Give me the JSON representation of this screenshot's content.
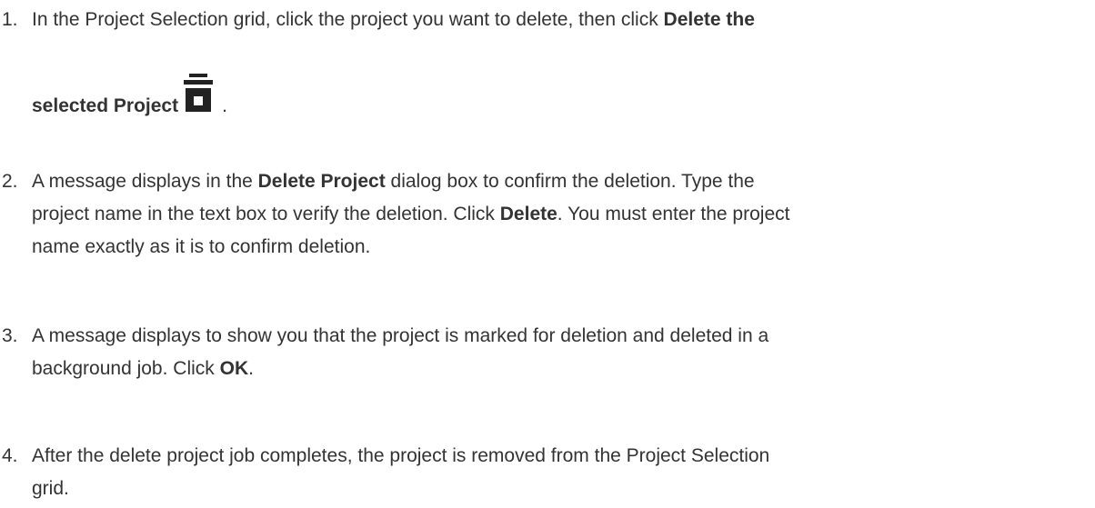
{
  "steps": [
    {
      "number": "1.",
      "line1_prefix": "In the Project Selection grid, click the project you want to delete, then click ",
      "line1_bold": "Delete the",
      "line2_bold": "selected Project",
      "line2_suffix": ".",
      "icon": "trash-can-icon"
    },
    {
      "number": "2.",
      "line1_prefix": "A message displays in the ",
      "line1_bold": "Delete Project",
      "line1_suffix": " dialog box to confirm the deletion. Type the",
      "line2_prefix": "project name in the text box to verify the deletion. Click ",
      "line2_bold": "Delete",
      "line2_suffix": ". You must enter the project",
      "line3": "name exactly as it is to confirm deletion."
    },
    {
      "number": "3.",
      "line1": "A message displays to show you that the project is marked for deletion and deleted in a",
      "line2_prefix": "background job. Click ",
      "line2_bold": "OK",
      "line2_suffix": "."
    },
    {
      "number": "4.",
      "line1": "After the delete project job completes, the project is removed from the Project Selection",
      "line2": "grid."
    }
  ]
}
